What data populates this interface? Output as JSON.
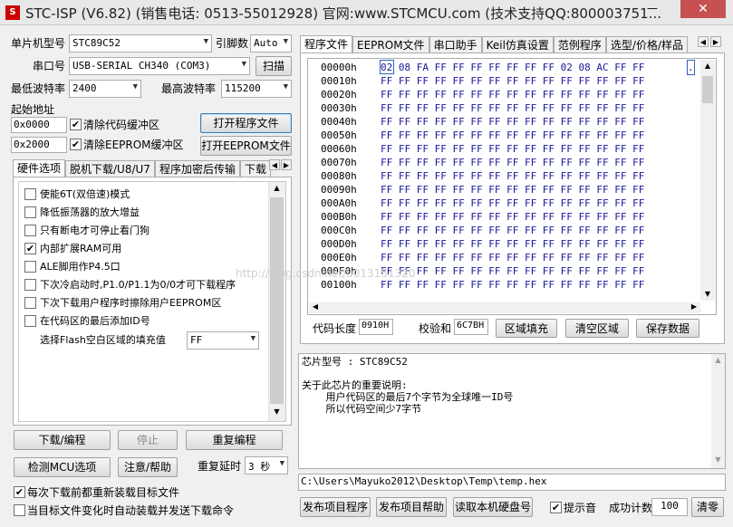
{
  "window": {
    "title": "STC-ISP (V6.82) (销售电话: 0513-55012928) 官网:www.STCMCU.com  (技术支持QQ:800003751...",
    "minimize": "—",
    "close": "✕",
    "app_icon": "S"
  },
  "left": {
    "mcu_type_label": "单片机型号",
    "mcu_type_value": "STC89C52",
    "pin_label": "引脚数",
    "pin_value": "Auto",
    "port_label": "串口号",
    "port_value": "USB-SERIAL CH340 (COM3)",
    "scan_button": "扫描",
    "min_baud_label": "最低波特率",
    "min_baud_value": "2400",
    "max_baud_label": "最高波特率",
    "max_baud_value": "115200",
    "start_addr_label": "起始地址",
    "addr1_value": "0x0000",
    "clear_code_label": "清除代码缓冲区",
    "open_program_button": "打开程序文件",
    "addr2_value": "0x2000",
    "clear_eeprom_label": "清除EEPROM缓冲区",
    "open_eeprom_button": "打开EEPROM文件",
    "tabs": [
      "硬件选项",
      "脱机下载/U8/U7",
      "程序加密后传输",
      "下载"
    ],
    "options": [
      {
        "label": "使能6T(双倍速)模式",
        "checked": false
      },
      {
        "label": "降低振荡器的放大增益",
        "checked": false
      },
      {
        "label": "只有断电才可停止看门狗",
        "checked": false
      },
      {
        "label": "内部扩展RAM可用",
        "checked": true
      },
      {
        "label": "ALE脚用作P4.5口",
        "checked": false
      },
      {
        "label": "下次冷启动时,P1.0/P1.1为0/0才可下载程序",
        "checked": false
      },
      {
        "label": "下次下载用户程序时擦除用户EEPROM区",
        "checked": false
      },
      {
        "label": "在代码区的最后添加ID号",
        "checked": false
      }
    ],
    "fill_label": "选择Flash空白区域的填充值",
    "fill_value": "FF",
    "download_button": "下载/编程",
    "stop_button": "停止",
    "redo_button": "重复编程",
    "check_mcu_button": "检测MCU选项",
    "help_button": "注意/帮助",
    "repeat_delay_label": "重复延时",
    "repeat_delay_value": "3 秒",
    "reload_label": "每次下载前都重新装载目标文件",
    "auto_load_label": "当目标文件变化时自动装载并发送下载命令"
  },
  "right": {
    "tabs": [
      "程序文件",
      "EEPROM文件",
      "串口助手",
      "Keil仿真设置",
      "范例程序",
      "选型/价格/样品"
    ],
    "hex_rows": [
      {
        "addr": "00000h",
        "bytes": "02 08 FA FF FF FF FF FF FF FF 02 08 AC FF FF",
        "ascii": "."
      },
      {
        "addr": "00010h",
        "bytes": "FF FF FF FF FF FF FF FF FF FF FF FF FF FF FF"
      },
      {
        "addr": "00020h",
        "bytes": "FF FF FF FF FF FF FF FF FF FF FF FF FF FF FF"
      },
      {
        "addr": "00030h",
        "bytes": "FF FF FF FF FF FF FF FF FF FF FF FF FF FF FF"
      },
      {
        "addr": "00040h",
        "bytes": "FF FF FF FF FF FF FF FF FF FF FF FF FF FF FF"
      },
      {
        "addr": "00050h",
        "bytes": "FF FF FF FF FF FF FF FF FF FF FF FF FF FF FF"
      },
      {
        "addr": "00060h",
        "bytes": "FF FF FF FF FF FF FF FF FF FF FF FF FF FF FF"
      },
      {
        "addr": "00070h",
        "bytes": "FF FF FF FF FF FF FF FF FF FF FF FF FF FF FF"
      },
      {
        "addr": "00080h",
        "bytes": "FF FF FF FF FF FF FF FF FF FF FF FF FF FF FF"
      },
      {
        "addr": "00090h",
        "bytes": "FF FF FF FF FF FF FF FF FF FF FF FF FF FF FF"
      },
      {
        "addr": "000A0h",
        "bytes": "FF FF FF FF FF FF FF FF FF FF FF FF FF FF FF"
      },
      {
        "addr": "000B0h",
        "bytes": "FF FF FF FF FF FF FF FF FF FF FF FF FF FF FF"
      },
      {
        "addr": "000C0h",
        "bytes": "FF FF FF FF FF FF FF FF FF FF FF FF FF FF FF"
      },
      {
        "addr": "000D0h",
        "bytes": "FF FF FF FF FF FF FF FF FF FF FF FF FF FF FF"
      },
      {
        "addr": "000E0h",
        "bytes": "FF FF FF FF FF FF FF FF FF FF FF FF FF FF FF"
      },
      {
        "addr": "000F0h",
        "bytes": "FF FF FF FF FF FF FF FF FF FF FF FF FF FF FF"
      },
      {
        "addr": "00100h",
        "bytes": "FF FF FF FF FF FF FF FF FF FF FF FF FF FF FF"
      }
    ],
    "code_len_label": "代码长度",
    "code_len_value": "0910H",
    "checksum_label": "校验和",
    "checksum_value": "6C7BH",
    "fill_area_button": "区域填充",
    "clear_area_button": "清空区域",
    "save_data_button": "保存数据",
    "info_text": "芯片型号 : STC89C52\n\n关于此芯片的重要说明:\n    用户代码区的最后7个字节为全球唯一ID号\n    所以代码空间少7字节",
    "file_path": "C:\\Users\\Mayuko2012\\Desktop\\Temp\\temp.hex",
    "publish_program_button": "发布项目程序",
    "publish_help_button": "发布项目帮助",
    "read_disk_button": "读取本机硬盘号",
    "beep_label": "提示音",
    "success_count_label": "成功计数",
    "success_count_value": "100",
    "clear_button": "清零"
  },
  "watermark": "http://blog.csdn.net/u013151320"
}
